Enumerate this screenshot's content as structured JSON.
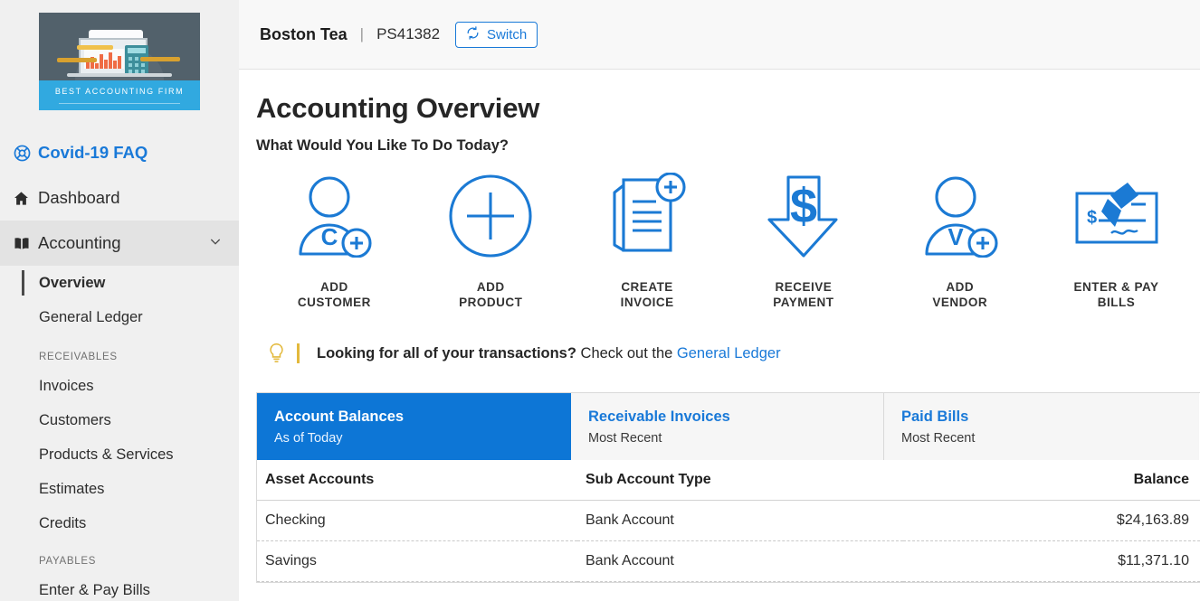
{
  "sidebar": {
    "logo": {
      "alt": "accounting-firm-logo",
      "banner_text": "BEST ACCOUNTING FIRM"
    },
    "nav": [
      {
        "label": "Covid-19 FAQ",
        "icon": "life-ring-icon",
        "name": "covid-19-faq"
      },
      {
        "label": "Dashboard",
        "icon": "home-icon",
        "name": "dashboard"
      },
      {
        "label": "Accounting",
        "icon": "book-icon",
        "name": "accounting",
        "chevron": "chevron-down-icon"
      }
    ],
    "accounting_children": [
      {
        "label": "Overview",
        "name": "overview",
        "current": true
      },
      {
        "label": "General Ledger",
        "name": "general-ledger",
        "current": false
      }
    ],
    "groups": [
      {
        "title": "RECEIVABLES",
        "items": [
          {
            "label": "Invoices",
            "name": "invoices"
          },
          {
            "label": "Customers",
            "name": "customers"
          },
          {
            "label": "Products & Services",
            "name": "products-services"
          },
          {
            "label": "Estimates",
            "name": "estimates"
          },
          {
            "label": "Credits",
            "name": "credits"
          }
        ]
      },
      {
        "title": "PAYABLES",
        "items": [
          {
            "label": "Enter & Pay Bills",
            "name": "enter-pay-bills"
          }
        ]
      }
    ]
  },
  "topbar": {
    "company": "Boston Tea",
    "separator": "|",
    "account_id": "PS41382",
    "switch_label": "Switch",
    "switch_icon": "refresh-icon"
  },
  "main": {
    "page_title": "Accounting Overview",
    "sub_title": "What Would You Like To Do Today?",
    "actions": [
      {
        "label": "ADD\nCUSTOMER",
        "icon": "add-customer-icon",
        "name": "add-customer"
      },
      {
        "label": "ADD\nPRODUCT",
        "icon": "add-product-icon",
        "name": "add-product"
      },
      {
        "label": "CREATE\nINVOICE",
        "icon": "create-invoice-icon",
        "name": "create-invoice"
      },
      {
        "label": "RECEIVE\nPAYMENT",
        "icon": "receive-payment-icon",
        "name": "receive-payment"
      },
      {
        "label": "ADD\nVENDOR",
        "icon": "add-vendor-icon",
        "name": "add-vendor"
      },
      {
        "label": "ENTER & PAY\nBILLS",
        "icon": "enter-pay-bills-icon",
        "name": "enter-pay-bills"
      }
    ],
    "tip": {
      "icon": "lightbulb-icon",
      "bold": "Looking for all of your transactions?",
      "text": " Check out the ",
      "link": "General Ledger"
    },
    "tabs": [
      {
        "title": "Account Balances",
        "subtitle": "As of Today",
        "name": "tab-account-balances",
        "active": true
      },
      {
        "title": "Receivable Invoices",
        "subtitle": "Most Recent",
        "name": "tab-receivable-invoices",
        "active": false
      },
      {
        "title": "Paid Bills",
        "subtitle": "Most Recent",
        "name": "tab-paid-bills",
        "active": false
      }
    ],
    "table": {
      "columns": [
        "Asset Accounts",
        "Sub Account Type",
        "Balance"
      ],
      "rows": [
        {
          "account": "Checking",
          "type": "Bank Account",
          "balance": "$24,163.89"
        },
        {
          "account": "Savings",
          "type": "Bank Account",
          "balance": "$11,371.10"
        }
      ]
    }
  },
  "colors": {
    "accent_blue": "#1979d8",
    "tab_active_blue": "#0d76d6",
    "icon_blue": "#1b7ad4",
    "sidebar_bg": "#f0f0f0",
    "tip_yellow": "#e3b93c"
  }
}
